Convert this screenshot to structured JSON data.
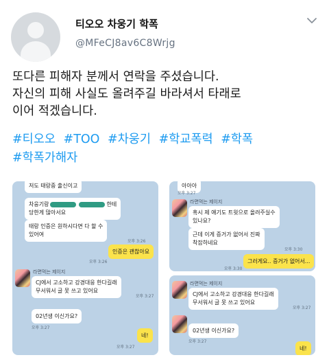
{
  "user": {
    "name": "티오오 차웅기 학폭",
    "handle": "@MFeCJ8av6C8Wrjg"
  },
  "tweet": {
    "lines": [
      "또다른 피해자 분께서 연락을 주셨습니다.",
      "자신의 피해 사실도 올려주길 바라셔서 타래로",
      "이어 적겠습니다."
    ],
    "hashtags": [
      "#티오오",
      "#TOO",
      "#차웅기",
      "#학교폭력",
      "#학폭",
      "#학폭가해자"
    ]
  },
  "chat_left": {
    "top_cut": "저도 태랑중 출신이고",
    "msg1_prefix": "차웅기랑",
    "msg1_suffix": "한테",
    "msg1_line2": "당한게 많아서요",
    "msg2_line1": "태랑 인증은 원하시다면 다 할 수",
    "msg2_line2": "있어여",
    "time1": "오후 3:26",
    "reply1": "인증은 괜찮아요",
    "time2": "오후 3:26",
    "sender": "라면먹는 제이지",
    "msg3_line1": "CJ에서 고소하고 강경대응 한다길래",
    "msg3_line2": "무서워서 글 못 쓰고 있어요",
    "time3": "오후 3:27",
    "msg4": "02년생 이신가요?",
    "time4": "오후 3:27",
    "reply2": "네!",
    "time5": "오후 3:27"
  },
  "chat_right_top": {
    "top_cut": "아아아",
    "time0": "오후 3:27",
    "sender": "라면먹는 제이지",
    "msg1_line1": "혹시 제 얘기도 트윗으로 올려주실수",
    "msg1_line2": "있나요?",
    "msg2_line1": "근데 이게 증거가 없어서 진짜",
    "msg2_line2": "착잡하네요",
    "time1": "오후 3:30",
    "reply": "그러게요.. 증거가 없어서...",
    "time2": "오후 3:30"
  },
  "chat_right_bottom": {
    "sender": "라면먹는 제이지",
    "msg1_line1": "CJ에서 고소하고 강경대응 한다길래",
    "msg1_line2": "무서워서 글 못 쓰고 있어요",
    "time1": "오후 3:27",
    "msg2": "02년생 이신가요?",
    "time2": "오후 3:27",
    "reply": "네!"
  }
}
